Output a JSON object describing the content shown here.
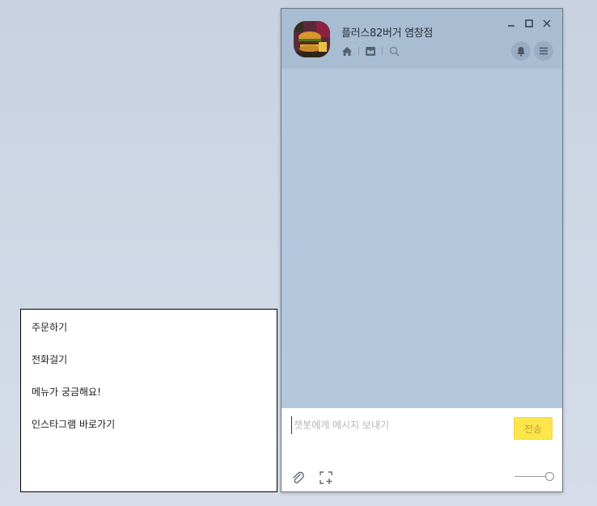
{
  "chat": {
    "title": "플러스82버거 염창점",
    "header_icons": [
      "home-icon",
      "inbox-icon",
      "search-icon"
    ],
    "window_controls": [
      "minimize-icon",
      "maximize-icon",
      "close-icon"
    ],
    "actions": [
      "bell-icon",
      "menu-icon"
    ],
    "input": {
      "placeholder": "챗봇에게 메시지 보내기",
      "value": ""
    },
    "send_label": "전송",
    "bottom_icons": [
      "attach-icon",
      "capture-icon"
    ]
  },
  "colors": {
    "chat_background": "#b3c8dc",
    "header_background": "#a8bdd2",
    "send_button": "#fde64b",
    "desktop": "#cdd6e4"
  },
  "menu": {
    "items": [
      {
        "label": "주문하기"
      },
      {
        "label": "전화걸기"
      },
      {
        "label": "메뉴가 궁금해요!"
      },
      {
        "label": "인스타그램 바로가기"
      }
    ]
  }
}
